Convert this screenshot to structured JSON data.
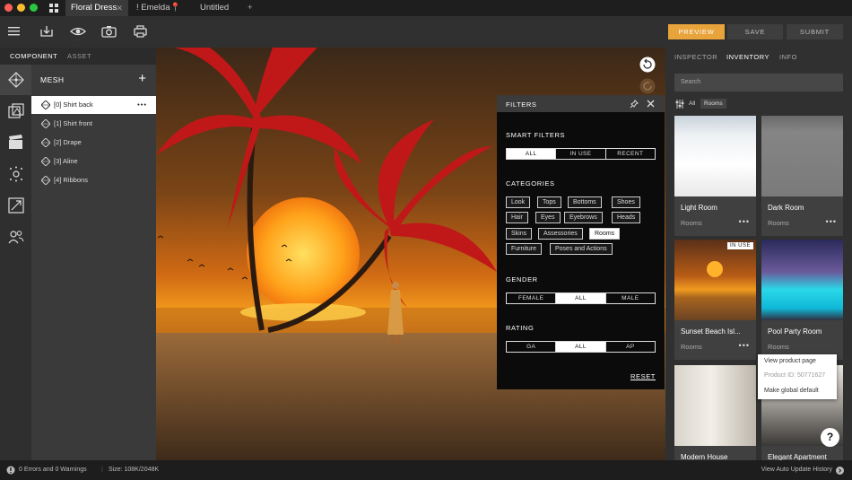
{
  "window": {
    "tabs": [
      {
        "label": "Floral Dress",
        "active": true
      },
      {
        "label": "! Emelda📍",
        "active": false
      },
      {
        "label": "Untitled",
        "active": false
      }
    ],
    "new_tab": "+"
  },
  "toolbar": {
    "preview": "PREVIEW",
    "save": "SAVE",
    "submit": "SUBMIT",
    "accent": "#e8a33a"
  },
  "left_panel": {
    "tabs": [
      "COMPONENT",
      "ASSET"
    ],
    "section_title": "MESH",
    "add": "+",
    "items": [
      "[0] Shirt back",
      "[1] Shirt front",
      "[2] Drape",
      "[3] Aline",
      "[4] Ribbons"
    ],
    "item_more": "•••"
  },
  "filters": {
    "title": "FILTERS",
    "smart_title": "SMART FILTERS",
    "smart": [
      "ALL",
      "IN USE",
      "RECENT"
    ],
    "categories_title": "CATEGORIES",
    "categories": [
      "Look",
      "Tops",
      "Bottoms",
      "Shoes",
      "Hair",
      "Eyes",
      "Eyebrows",
      "Heads",
      "Skins",
      "Assessories",
      "Rooms",
      "Furniture",
      "Poses and Actions"
    ],
    "gender_title": "GENDER",
    "gender": [
      "FEMALE",
      "ALL",
      "MALE"
    ],
    "rating_title": "RATING",
    "rating": [
      "GA",
      "ALL",
      "AP"
    ],
    "reset": "RESET"
  },
  "right_panel": {
    "tabs": [
      "INSPECTOR",
      "INVENTORY",
      "INFO"
    ],
    "search_placeholder": "Search",
    "filter_all": "All",
    "filter_chip": "Rooms",
    "cards": [
      {
        "name": "Light Room",
        "category": "Rooms",
        "badge": ""
      },
      {
        "name": "Dark Room",
        "category": "Rooms",
        "badge": ""
      },
      {
        "name": "Sunset Beach Isl...",
        "category": "Rooms",
        "badge": "IN USE"
      },
      {
        "name": "Pool Party Room",
        "category": "Rooms",
        "badge": ""
      },
      {
        "name": "Modern House",
        "category": "",
        "badge": ""
      },
      {
        "name": "Elegant Apartment",
        "category": "",
        "badge": ""
      }
    ],
    "card_more": "•••",
    "context_menu": {
      "view": "View product page",
      "product_id": "Product ID: 50771627",
      "make_default": "Make global default"
    },
    "help": "?"
  },
  "status": {
    "errors": "0 Errors and 0 Warnings",
    "size": "Size: 108K/2048K",
    "history": "View Auto Update History"
  }
}
